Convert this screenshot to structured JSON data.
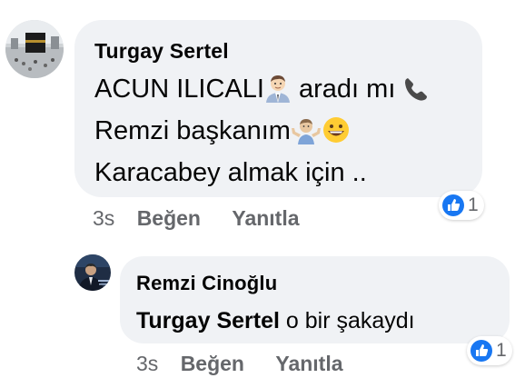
{
  "comments": [
    {
      "author": "Turgay Sertel",
      "lines": {
        "l1_text": "ACUN ILICALI",
        "l1_after": " aradı mı ",
        "l2_text": "Remzi başkanım",
        "l3_text": "Karacabey almak için .."
      },
      "emojis": {
        "l1_person": "man-office-worker-emoji",
        "l1_phone": "telephone-emoji",
        "l2_shrug": "person-shrugging-emoji",
        "l2_smile": "grinning-face-emoji"
      },
      "time": "3s",
      "like_label": "Beğen",
      "reply_label": "Yanıtla",
      "reaction_count": "1",
      "reaction_icon": "like-reaction-icon"
    },
    {
      "author": "Remzi Cinoğlu",
      "mention": "Turgay Sertel",
      "text": " o bir şakaydı",
      "time": "3s",
      "like_label": "Beğen",
      "reply_label": "Yanıtla",
      "reaction_count": "1",
      "reaction_icon": "like-reaction-icon"
    }
  ],
  "colors": {
    "bubble": "#f0f2f5",
    "text": "#050505",
    "meta": "#65676b",
    "like_blue": "#1877f2"
  }
}
